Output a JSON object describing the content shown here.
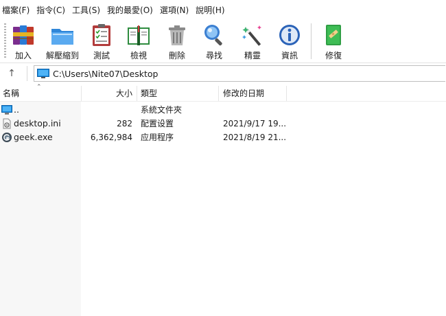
{
  "menu": [
    {
      "label": "檔案(F)"
    },
    {
      "label": "指令(C)"
    },
    {
      "label": "工具(S)"
    },
    {
      "label": "我的最愛(O)"
    },
    {
      "label": "選項(N)"
    },
    {
      "label": "說明(H)"
    }
  ],
  "toolbar": {
    "buttons": [
      {
        "label": "加入",
        "icon": "books-add-icon"
      },
      {
        "label": "解壓縮到",
        "icon": "folder-extract-icon"
      },
      {
        "label": "測試",
        "icon": "clipboard-test-icon"
      },
      {
        "label": "檢視",
        "icon": "book-view-icon"
      },
      {
        "label": "刪除",
        "icon": "trash-can-icon"
      },
      {
        "label": "尋找",
        "icon": "magnifier-icon"
      },
      {
        "label": "精靈",
        "icon": "magic-wand-icon"
      },
      {
        "label": "資訊",
        "icon": "info-icon"
      },
      {
        "label": "修復",
        "icon": "repair-book-icon"
      }
    ]
  },
  "address": {
    "path": "C:\\Users\\Nite07\\Desktop",
    "icon": "monitor-icon"
  },
  "columns": {
    "name": "名稱",
    "size": "大小",
    "type": "類型",
    "modified": "修改的日期"
  },
  "files": [
    {
      "name": "..",
      "size": "",
      "type": "系統文件夾",
      "modified": "",
      "icon": "folder-up-monitor-icon"
    },
    {
      "name": "desktop.ini",
      "size": "282",
      "type": "配置设置",
      "modified": "2021/9/17 19...",
      "icon": "settings-file-icon"
    },
    {
      "name": "geek.exe",
      "size": "6,362,984",
      "type": "应用程序",
      "modified": "2021/8/19 21...",
      "icon": "geek-app-icon"
    }
  ]
}
